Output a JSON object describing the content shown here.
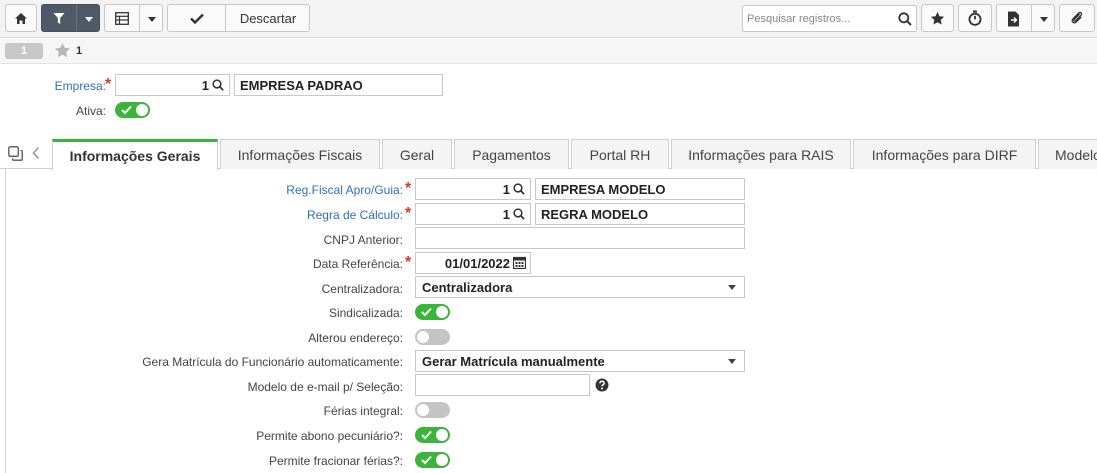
{
  "toolbar": {
    "discard_label": "Descartar",
    "search_placeholder": "Pesquisar registros..."
  },
  "record": {
    "index": "1",
    "id": "1"
  },
  "header": {
    "empresa_label": "Empresa:",
    "empresa_code": "1",
    "empresa_name": "EMPRESA PADRAO",
    "ativa_label": "Ativa:"
  },
  "tabs": [
    {
      "label": "Informações Gerais"
    },
    {
      "label": "Informações Fiscais"
    },
    {
      "label": "Geral"
    },
    {
      "label": "Pagamentos"
    },
    {
      "label": "Portal RH"
    },
    {
      "label": "Informações para RAIS"
    },
    {
      "label": "Informações para DIRF"
    },
    {
      "label": "Modelos"
    }
  ],
  "form": {
    "reg_fiscal_label": "Reg.Fiscal Apro/Guia:",
    "reg_fiscal_code": "1",
    "reg_fiscal_name": "EMPRESA MODELO",
    "regra_calculo_label": "Regra de Cálculo:",
    "regra_calculo_code": "1",
    "regra_calculo_name": "REGRA MODELO",
    "cnpj_anterior_label": "CNPJ Anterior:",
    "cnpj_anterior_value": "",
    "data_referencia_label": "Data Referência:",
    "data_referencia_value": "01/01/2022",
    "centralizadora_label": "Centralizadora:",
    "centralizadora_value": "Centralizadora",
    "sindicalizada_label": "Sindicalizada:",
    "alterou_endereco_label": "Alterou endereço:",
    "gera_matricula_label": "Gera Matrícula do Funcionário automaticamente:",
    "gera_matricula_value": "Gerar Matrícula manualmente",
    "modelo_email_label": "Modelo de e-mail p/ Seleção:",
    "modelo_email_value": "",
    "ferias_integral_label": "Férias integral:",
    "abono_label": "Permite abono pecuniário?:",
    "fracionar_label": "Permite fracionar férias?:"
  },
  "toggles": {
    "ativa": true,
    "sindicalizada": true,
    "alterou_endereco": false,
    "ferias_integral": false,
    "abono": true,
    "fracionar": true
  },
  "icons": {
    "home": "home-icon",
    "filter": "filter-icon",
    "table": "table-icon",
    "check": "check-icon",
    "search": "search-icon",
    "star": "star-icon",
    "timer": "timer-icon",
    "export": "export-file-icon",
    "attach": "paperclip-icon",
    "help": "help-icon"
  },
  "colors": {
    "accent_green": "#3cb43c",
    "link_blue": "#2f6fc0",
    "required_red": "#d9392b",
    "dark_button": "#4f5a66"
  }
}
